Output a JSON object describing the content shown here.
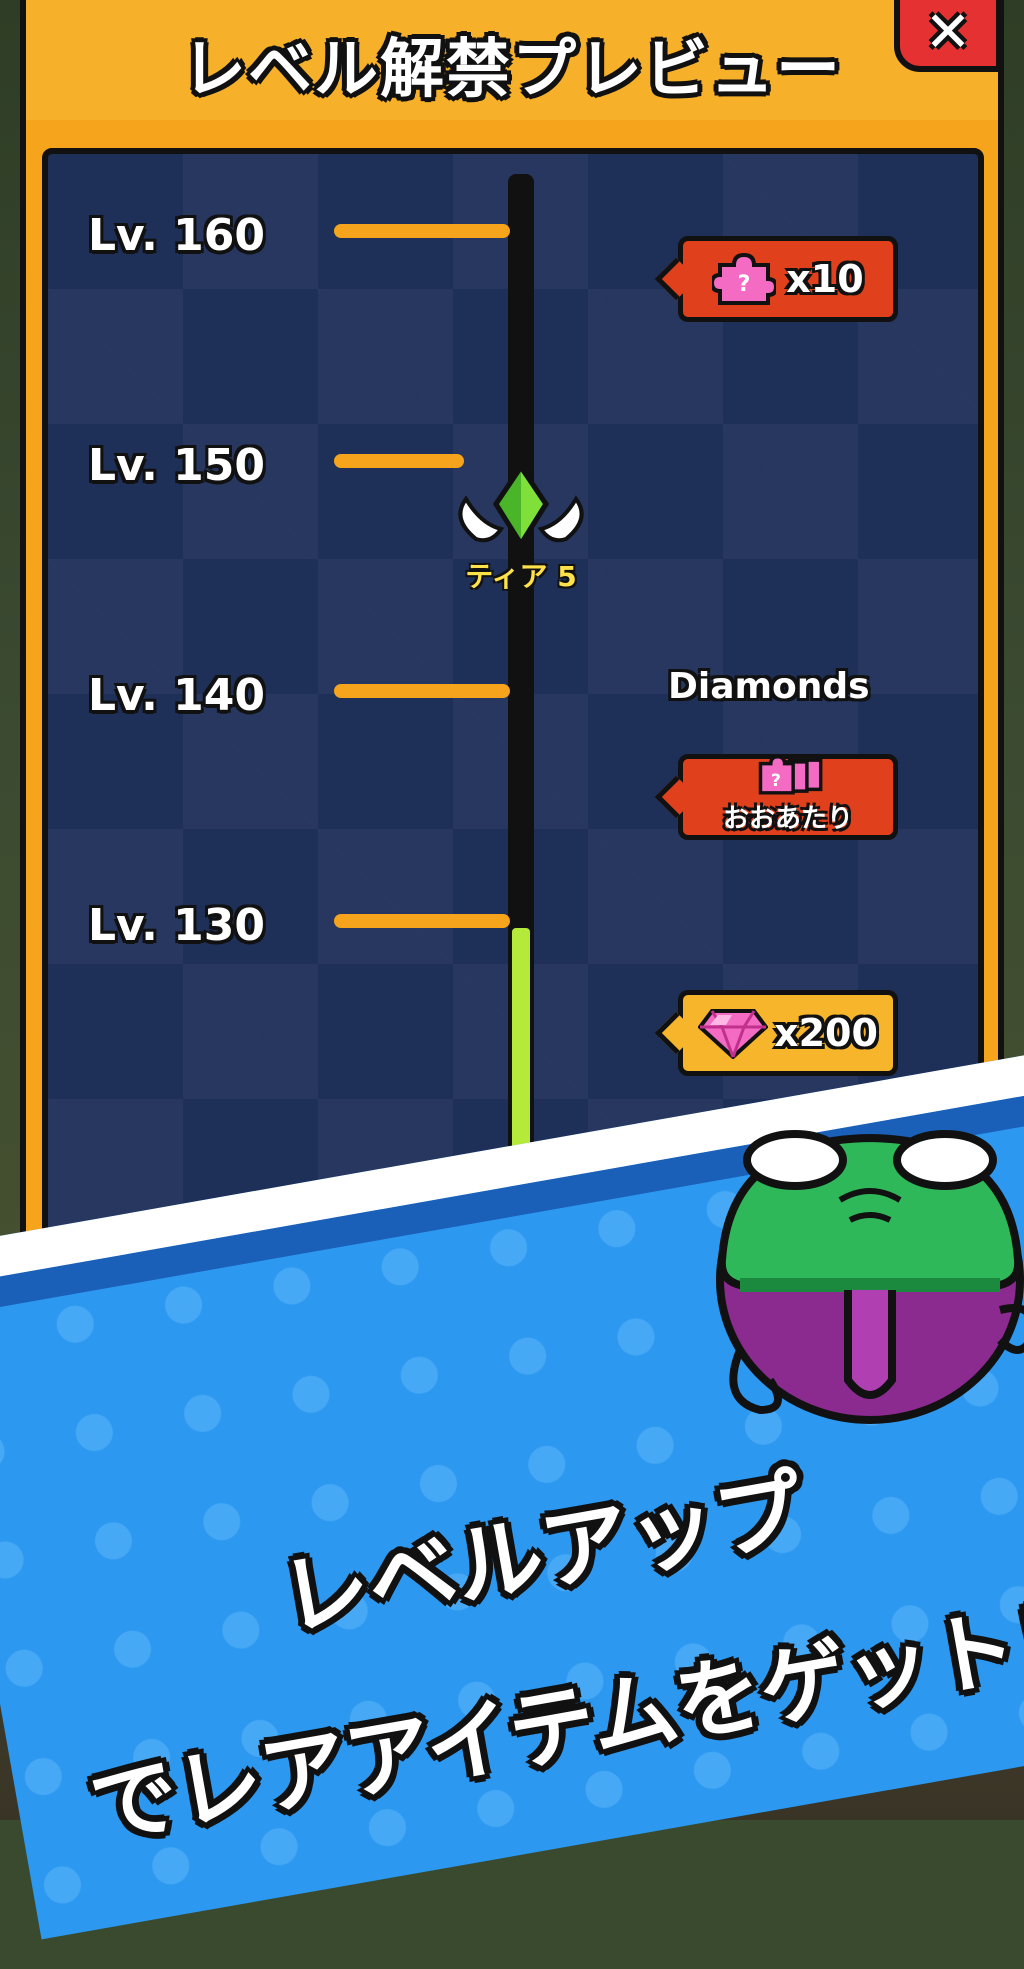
{
  "title": "レベル解禁プレビュー",
  "close_label": "✕",
  "levels": [
    {
      "label": "Lv. 160"
    },
    {
      "label": "Lv. 150"
    },
    {
      "label": "Lv. 140"
    },
    {
      "label": "Lv. 130"
    }
  ],
  "progress_fraction": 0.3,
  "tier_marker": {
    "label": "ティア 5",
    "icon": "winged-green-gem-icon"
  },
  "rewards": [
    {
      "level": "Lv. 160",
      "icon": "pink-puzzle-piece-icon",
      "text": "x10",
      "style": "red"
    },
    {
      "level": "Lv. 140",
      "icon": "pink-puzzle-pieces-stack-icon",
      "text": "おおあたり",
      "style": "red",
      "caption": "Diamonds"
    },
    {
      "level": "Lv. 130",
      "icon": "pink-gem-icon",
      "text": "x200",
      "style": "gold"
    }
  ],
  "promo": {
    "line1": "レベルアップ",
    "line2": "でレアアイテムをゲット！"
  },
  "colors": {
    "accent": "#f5a41c",
    "panel": "#1e2f58",
    "progress": "#b5ea3a",
    "reward_red": "#e0401b",
    "reward_gold": "#f7b52b",
    "banner": "#2c98f0"
  }
}
